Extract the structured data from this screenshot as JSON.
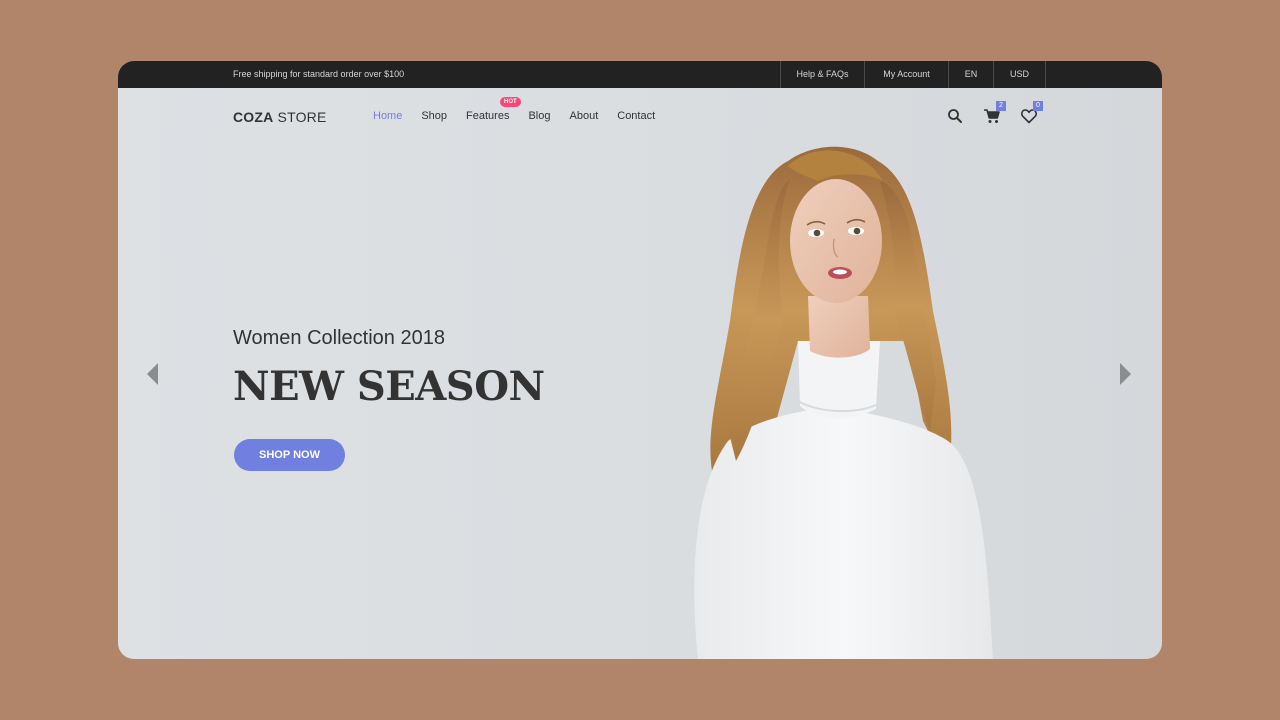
{
  "topbar": {
    "promo": "Free shipping for standard order over $100",
    "links": {
      "help": "Help & FAQs",
      "account": "My Account",
      "lang": "EN",
      "currency": "USD"
    }
  },
  "header": {
    "logo_bold": "COZA",
    "logo_rest": " STORE",
    "nav": {
      "home": "Home",
      "shop": "Shop",
      "features": "Features",
      "blog": "Blog",
      "about": "About",
      "contact": "Contact"
    },
    "hot_badge": "HOT",
    "cart_count": "2",
    "wishlist_count": "0",
    "icons": [
      "search-icon",
      "cart-icon",
      "heart-icon"
    ]
  },
  "hero": {
    "subtitle": "Women Collection 2018",
    "title": "NEW SEASON",
    "cta": "SHOP NOW",
    "arrows": [
      "arrow-left-icon",
      "arrow-right-icon"
    ]
  },
  "colors": {
    "accent": "#717fe0",
    "hot": "#f74877",
    "topbar": "#222222",
    "page_bg": "#b0856a"
  }
}
